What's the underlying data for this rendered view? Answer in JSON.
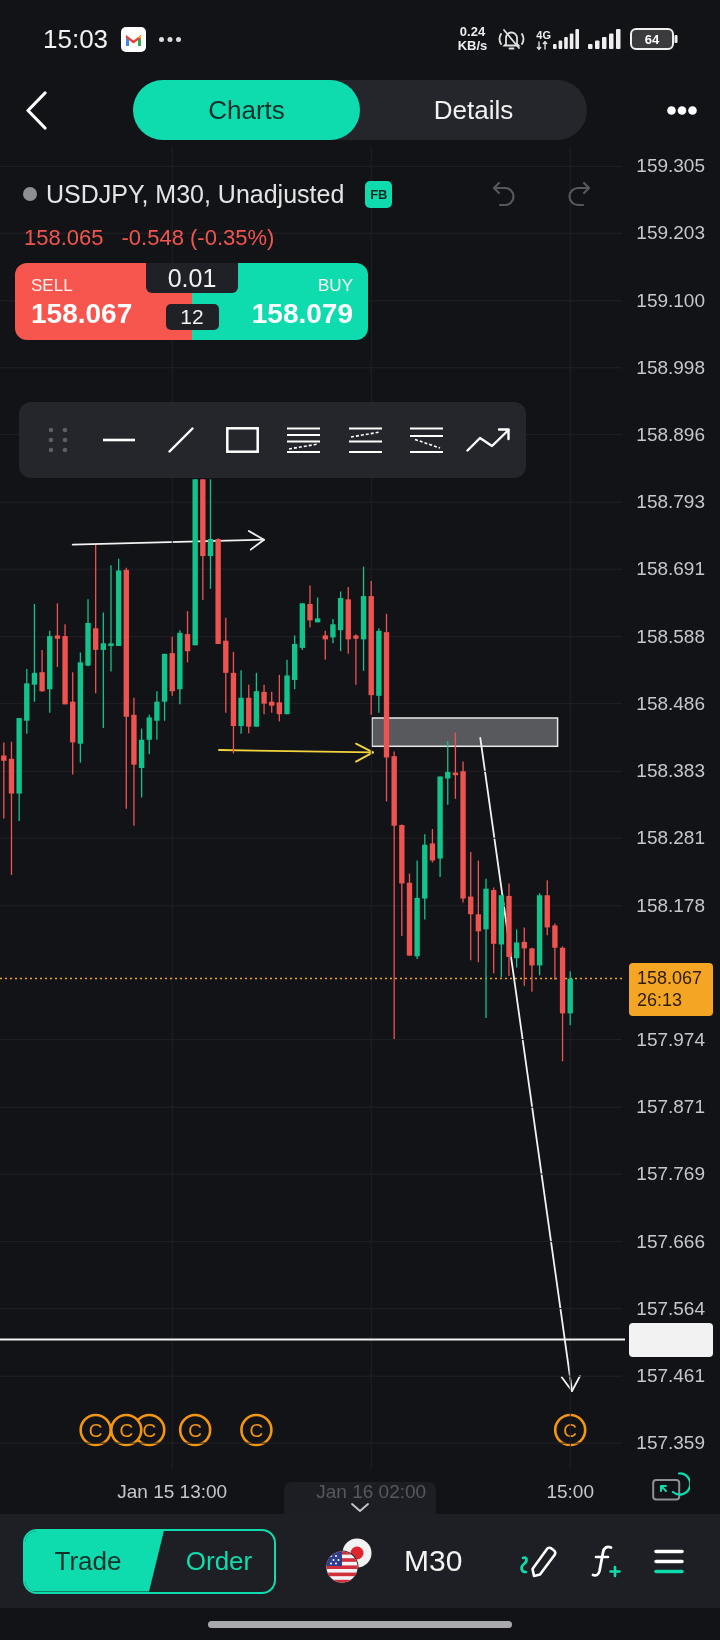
{
  "status_bar": {
    "time": "15:03",
    "net_speed": "0.24",
    "net_speed_unit": "KB/s",
    "network_type": "4G",
    "battery": "64"
  },
  "header": {
    "tabs": [
      {
        "label": "Charts",
        "selected": true
      },
      {
        "label": "Details",
        "selected": false
      }
    ]
  },
  "symbol": {
    "title": "USDJPY, M30, Unadjusted",
    "badge": "FB",
    "last_price": "158.065",
    "change": "-0.548 (-0.35%)",
    "undo": {
      "disabled": true
    },
    "redo": {
      "disabled": true
    }
  },
  "quote_panel": {
    "sell_label": "SELL",
    "sell_price": "158.067",
    "lot_size": "0.01",
    "spread": "12",
    "buy_label": "BUY",
    "buy_price": "158.079"
  },
  "chart": {
    "chart_data": {
      "type": "candlestick",
      "categories": [
        null,
        null,
        null,
        null,
        null,
        null,
        null,
        null,
        null,
        null,
        null,
        null,
        null,
        null,
        null,
        null,
        null,
        null,
        null,
        null,
        null,
        null,
        "Jan 15 13:00",
        null,
        null,
        null,
        null,
        null,
        null,
        null,
        null,
        null,
        null,
        null,
        null,
        null,
        null,
        null,
        null,
        null,
        null,
        null,
        null,
        null,
        null,
        null,
        null,
        null,
        "Jan 16 02:00",
        null,
        null,
        null,
        null,
        null,
        null,
        null,
        null,
        null,
        null,
        null,
        null,
        null,
        null,
        null,
        null,
        null,
        null,
        null,
        null,
        null,
        null,
        null,
        null,
        null,
        "15:00"
      ],
      "ohlc": [
        [
          158.407,
          158.427,
          158.311,
          158.399
        ],
        [
          158.402,
          158.428,
          158.225,
          158.349
        ],
        [
          158.349,
          158.464,
          158.307,
          158.464
        ],
        [
          158.46,
          158.539,
          158.44,
          158.517
        ],
        [
          158.515,
          158.638,
          158.489,
          158.533
        ],
        [
          158.534,
          158.568,
          158.504,
          158.505
        ],
        [
          158.508,
          158.597,
          158.472,
          158.589
        ],
        [
          158.59,
          158.639,
          158.542,
          158.585
        ],
        [
          158.589,
          158.607,
          158.485,
          158.485
        ],
        [
          158.489,
          158.534,
          158.378,
          158.427
        ],
        [
          158.425,
          158.564,
          158.396,
          158.549
        ],
        [
          158.544,
          158.645,
          158.543,
          158.609
        ],
        [
          158.601,
          158.728,
          158.502,
          158.568
        ],
        [
          158.568,
          158.625,
          158.449,
          158.578
        ],
        [
          158.574,
          158.697,
          158.535,
          158.578
        ],
        [
          158.574,
          158.707,
          158.574,
          158.689
        ],
        [
          158.69,
          158.693,
          158.326,
          158.466
        ],
        [
          158.469,
          158.495,
          158.3,
          158.393
        ],
        [
          158.388,
          158.448,
          158.343,
          158.431
        ],
        [
          158.431,
          158.469,
          158.409,
          158.465
        ],
        [
          158.46,
          158.505,
          158.431,
          158.489
        ],
        [
          158.489,
          158.562,
          158.46,
          158.562
        ],
        [
          158.563,
          158.588,
          158.498,
          158.505
        ],
        [
          158.508,
          158.598,
          158.485,
          158.594
        ],
        [
          158.592,
          158.627,
          158.549,
          158.566
        ],
        [
          158.575,
          158.828,
          158.575,
          158.828
        ],
        [
          158.828,
          158.828,
          158.644,
          158.711
        ],
        [
          158.711,
          158.828,
          158.661,
          158.737
        ],
        [
          158.737,
          158.738,
          158.577,
          158.577
        ],
        [
          158.582,
          158.617,
          158.472,
          158.533
        ],
        [
          158.533,
          158.565,
          158.41,
          158.452
        ],
        [
          158.452,
          158.537,
          158.44,
          158.495
        ],
        [
          158.495,
          158.515,
          158.441,
          158.451
        ],
        [
          158.451,
          158.533,
          158.451,
          158.505
        ],
        [
          158.504,
          158.515,
          158.47,
          158.486
        ],
        [
          158.489,
          158.504,
          158.472,
          158.483
        ],
        [
          158.488,
          158.53,
          158.459,
          158.47
        ],
        [
          158.47,
          158.553,
          158.47,
          158.529
        ],
        [
          158.522,
          158.59,
          158.508,
          158.577
        ],
        [
          158.571,
          158.639,
          158.568,
          158.639
        ],
        [
          158.638,
          158.666,
          158.602,
          158.613
        ],
        [
          158.61,
          158.648,
          158.61,
          158.616
        ],
        [
          158.59,
          158.597,
          158.553,
          158.584
        ],
        [
          158.587,
          158.615,
          158.578,
          158.607
        ],
        [
          158.598,
          158.657,
          158.566,
          158.647
        ],
        [
          158.645,
          158.664,
          158.562,
          158.584
        ],
        [
          158.59,
          158.592,
          158.515,
          158.585
        ],
        [
          158.584,
          158.695,
          158.536,
          158.65
        ],
        [
          158.65,
          158.673,
          158.469,
          158.499
        ],
        [
          158.498,
          158.601,
          158.472,
          158.597
        ],
        [
          158.595,
          158.623,
          158.337,
          158.404
        ],
        [
          158.406,
          158.413,
          157.975,
          158.3
        ],
        [
          158.301,
          158.302,
          158.132,
          158.212
        ],
        [
          158.213,
          158.227,
          158.102,
          158.102
        ],
        [
          158.101,
          158.247,
          158.097,
          158.19
        ],
        [
          158.189,
          158.287,
          158.157,
          158.271
        ],
        [
          158.273,
          158.295,
          158.244,
          158.247
        ],
        [
          158.25,
          158.375,
          158.222,
          158.375
        ],
        [
          158.372,
          158.429,
          158.332,
          158.382
        ],
        [
          158.381,
          158.442,
          158.341,
          158.377
        ],
        [
          158.383,
          158.398,
          158.183,
          158.189
        ],
        [
          158.192,
          158.26,
          158.095,
          158.165
        ],
        [
          158.165,
          158.247,
          158.092,
          158.139
        ],
        [
          158.142,
          158.219,
          158.007,
          158.204
        ],
        [
          158.202,
          158.206,
          158.075,
          158.12
        ],
        [
          158.119,
          158.194,
          158.069,
          158.194
        ],
        [
          158.193,
          158.212,
          158.071,
          158.1
        ],
        [
          158.098,
          158.142,
          158.084,
          158.122
        ],
        [
          158.123,
          158.145,
          158.056,
          158.113
        ],
        [
          158.113,
          158.114,
          158.047,
          158.087
        ],
        [
          158.087,
          158.197,
          158.072,
          158.194
        ],
        [
          158.194,
          158.217,
          158.133,
          158.145
        ],
        [
          158.148,
          158.151,
          158.065,
          158.114
        ],
        [
          158.114,
          158.116,
          157.941,
          158.014
        ],
        [
          158.014,
          158.078,
          157.996,
          158.067
        ]
      ],
      "ylim": [
        157.318,
        159.336
      ],
      "yticks": [
        159.305,
        159.203,
        {
          "value": 159.1,
          "label": "159.100"
        },
        158.998,
        158.896,
        158.793,
        158.691,
        158.588,
        158.486,
        158.383,
        158.281,
        158.178,
        157.974,
        157.871,
        157.769,
        157.666,
        157.564,
        157.461,
        157.359
      ],
      "grid": true,
      "ref_lines": [
        {
          "axis": "y",
          "value": 158.067,
          "label": "158.067",
          "color": "#f5a524"
        },
        {
          "axis": "y",
          "value": 157.517,
          "color": "#f2f2f2"
        }
      ]
    },
    "countdown": "26:13",
    "event_markers": [
      {
        "label": "C"
      },
      {
        "label": "C"
      },
      {
        "label": "C"
      },
      {
        "label": "C"
      },
      {
        "label": "C"
      },
      {
        "label": "C"
      }
    ]
  },
  "bottom_bar": {
    "order_buttons": [
      {
        "label": "Trade",
        "selected": true
      },
      {
        "label": "Order",
        "selected": false
      }
    ],
    "timeframe": "M30"
  }
}
